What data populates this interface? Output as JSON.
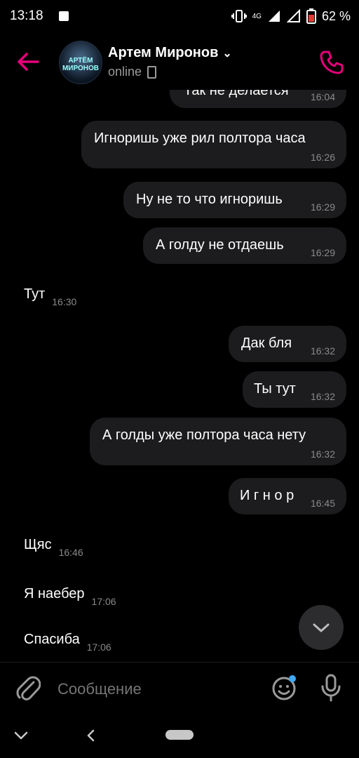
{
  "status_bar": {
    "time": "13:18",
    "network": "4G",
    "battery": "62 %"
  },
  "header": {
    "contact_name": "Артем Миронов",
    "status": "online",
    "avatar_text_1": "АРТЁМ",
    "avatar_text_2": "МИРОНОВ"
  },
  "messages": [
    {
      "text": "Так не делается",
      "time": "16:04"
    },
    {
      "text": "Игноришь уже рил полтора часа",
      "time": "16:26"
    },
    {
      "text": "Ну не то что игноришь",
      "time": "16:29"
    },
    {
      "text": "А голду не отдаешь",
      "time": "16:29"
    },
    {
      "text": "Тут",
      "time": "16:30"
    },
    {
      "text": "Дак бля",
      "time": "16:32"
    },
    {
      "text": "Ты тут",
      "time": "16:32"
    },
    {
      "text": "А голды уже полтора часа нету",
      "time": "16:32"
    },
    {
      "text": "И г н о р",
      "time": "16:45"
    },
    {
      "text": "Щяс",
      "time": "16:46"
    },
    {
      "text": "Я наебер",
      "time": "17:06"
    },
    {
      "text": "Спасиба",
      "time": "17:06"
    }
  ],
  "composer": {
    "placeholder": "Сообщение"
  },
  "colors": {
    "accent": "#e6007a",
    "bubble": "#1c1c1e",
    "secondary_text": "#8a8a8a"
  }
}
